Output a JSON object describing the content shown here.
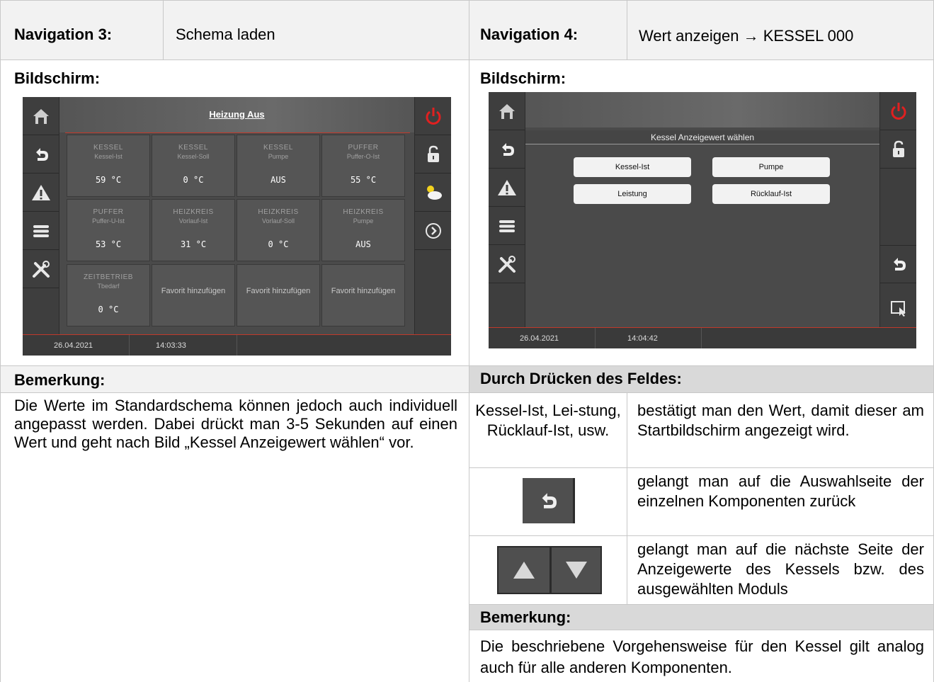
{
  "left": {
    "nav_label": "Navigation 3:",
    "nav_value": "Schema laden",
    "screen_label": "Bildschirm:",
    "remark_label": "Bemerkung:",
    "remark_text": "Die Werte im Standardschema können jedoch auch individuell angepasst werden. Dabei drückt man 3-5 Sekunden auf einen Wert und geht nach Bild „Kessel Anzeigewert wählen“ vor.",
    "device": {
      "title": "Heizung Aus",
      "tiles": [
        {
          "l1": "KESSEL",
          "l2": "Kessel-Ist",
          "value": "59 °C"
        },
        {
          "l1": "KESSEL",
          "l2": "Kessel-Soll",
          "value": "0 °C"
        },
        {
          "l1": "KESSEL",
          "l2": "Pumpe",
          "value": "AUS"
        },
        {
          "l1": "PUFFER",
          "l2": "Puffer-O-Ist",
          "value": "55 °C"
        },
        {
          "l1": "PUFFER",
          "l2": "Puffer-U-Ist",
          "value": "53 °C"
        },
        {
          "l1": "HEIZKREIS",
          "l2": "Vorlauf-Ist",
          "value": "31 °C"
        },
        {
          "l1": "HEIZKREIS",
          "l2": "Vorlauf-Soll",
          "value": "0 °C"
        },
        {
          "l1": "HEIZKREIS",
          "l2": "Pumpe",
          "value": "AUS"
        },
        {
          "l1": "ZEITBETRIEB",
          "l2": "Tbedarf",
          "value": "0 °C"
        }
      ],
      "fav": "Favorit hinzufügen",
      "date": "26.04.2021",
      "time": "14:03:33"
    }
  },
  "right": {
    "nav_label": "Navigation 4:",
    "nav_value": "Wert anzeigen",
    "nav_arrow": "→",
    "nav_target": "KESSEL 000",
    "screen_label": "Bildschirm:",
    "press_label": "Durch Drücken des Feldes:",
    "rows": [
      {
        "left": "Kessel-Ist, Lei-stung, Rücklauf-Ist, usw.",
        "right": "bestätigt man den Wert, damit dieser am Startbildschirm angezeigt wird."
      },
      {
        "left": "",
        "right": "gelangt man auf die Auswahlseite der einzelnen Komponenten zurück"
      },
      {
        "left": "",
        "right": "gelangt man auf die nächste Seite der Anzeigewerte des Kessels bzw. des ausgewählten Moduls"
      }
    ],
    "remark_label": "Bemerkung:",
    "remark_text": "Die beschriebene Vorgehensweise für den Kessel gilt analog auch für alle anderen Komponenten.",
    "device": {
      "title": "Kessel Anzeigewert wählen",
      "buttons": [
        "Kessel-Ist",
        "Pumpe",
        "Leistung",
        "Rücklauf-Ist"
      ],
      "date": "26.04.2021",
      "time": "14:04:42"
    }
  }
}
